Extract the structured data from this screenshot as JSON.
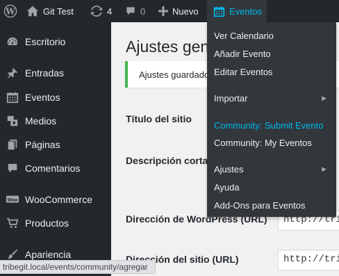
{
  "adminbar": {
    "site_name": "Git Test",
    "updates_count": "4",
    "comments_count": "0",
    "new_label": "Nuevo",
    "events_label": "Eventos"
  },
  "events_menu": {
    "items": [
      {
        "label": "Ver Calendario",
        "has_submenu": false,
        "highlighted": false
      },
      {
        "label": "Añadir Evento",
        "has_submenu": false,
        "highlighted": false
      },
      {
        "label": "Editar Eventos",
        "has_submenu": false,
        "highlighted": false
      },
      {
        "label": "Importar",
        "has_submenu": true,
        "highlighted": false
      },
      {
        "label": "Community: Submit Evento",
        "has_submenu": false,
        "highlighted": true
      },
      {
        "label": "Community: My Eventos",
        "has_submenu": false,
        "highlighted": false
      },
      {
        "label": "Ajustes",
        "has_submenu": true,
        "highlighted": false
      },
      {
        "label": "Ayuda",
        "has_submenu": false,
        "highlighted": false
      },
      {
        "label": "Add-Ons para Eventos",
        "has_submenu": false,
        "highlighted": false
      }
    ],
    "submenu_arrow": "▶"
  },
  "sidebar": {
    "items": [
      {
        "label": "Escritorio",
        "icon": "dashboard-icon"
      },
      {
        "label": "Entradas",
        "icon": "pin-icon"
      },
      {
        "label": "Eventos",
        "icon": "calendar-icon"
      },
      {
        "label": "Medios",
        "icon": "media-icon"
      },
      {
        "label": "Páginas",
        "icon": "pages-icon"
      },
      {
        "label": "Comentarios",
        "icon": "comment-icon"
      },
      {
        "label": "WooCommerce",
        "icon": "woo-icon"
      },
      {
        "label": "Productos",
        "icon": "cart-icon"
      },
      {
        "label": "Apariencia",
        "icon": "brush-icon"
      }
    ]
  },
  "main": {
    "page_title": "Ajustes generales",
    "notice": "Ajustes guardados.",
    "fields": [
      {
        "label": "Título del sitio"
      },
      {
        "label": "Descripción corta"
      },
      {
        "label": "Dirección de WordPress (URL)",
        "value": "http://tribegit.local"
      },
      {
        "label": "Dirección del sitio (URL)",
        "value": "http://tribegit.local"
      }
    ]
  },
  "statusbar": {
    "url": "tribegit.local/events/community/agregar"
  },
  "colors": {
    "adminbar_bg": "#23282d",
    "dropdown_bg": "#32373c",
    "highlight": "#00b9eb",
    "notice_border": "#46b450"
  }
}
